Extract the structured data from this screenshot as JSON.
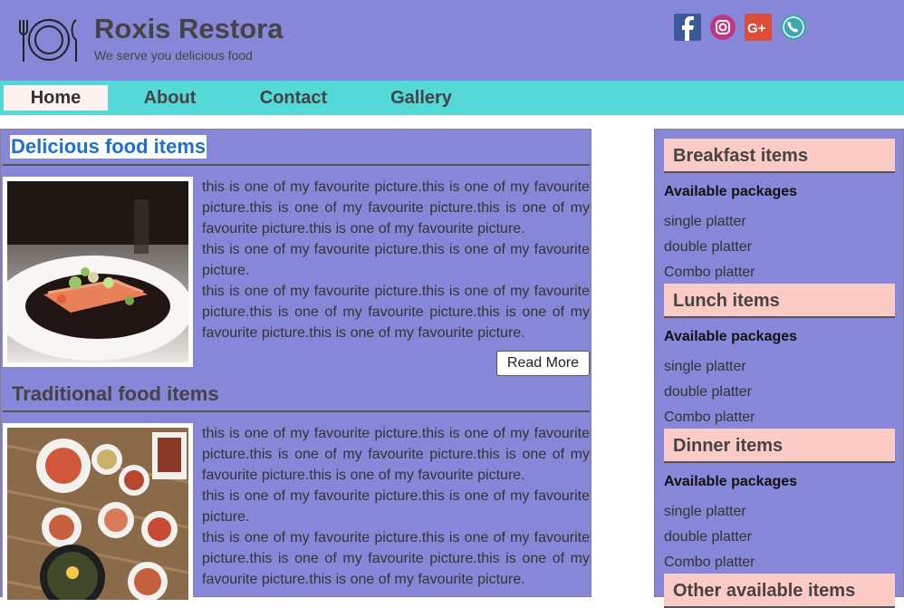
{
  "header": {
    "brand": "Roxis Restora",
    "tagline": "We serve you delicious food",
    "social": [
      "facebook-icon",
      "instagram-icon",
      "google-plus-icon",
      "phone-icon"
    ]
  },
  "nav": {
    "items": [
      "Home",
      "About",
      "Contact",
      "Gallery"
    ],
    "active": "Home"
  },
  "main": {
    "sections": [
      {
        "title": "Delicious food items",
        "paragraphs": [
          "this is one of my favourite picture.this is one of my favourite picture.this is one of my favourite picture.this is one of my favourite picture.this is one of my favourite picture.",
          "this is one of my favourite picture.this is one of my favourite picture.",
          "this is one of my favourite picture.this is one of my favourite picture.this is one of my favourite picture.this is one of my favourite picture.this is one of my favourite picture."
        ],
        "button": "Read More"
      },
      {
        "title": "Traditional food items",
        "paragraphs": [
          "this is one of my favourite picture.this is one of my favourite picture.this is one of my favourite picture.this is one of my favourite picture.this is one of my favourite picture.",
          "this is one of my favourite picture.this is one of my favourite picture.",
          "this is one of my favourite picture.this is one of my favourite picture.this is one of my favourite picture.this is one of my favourite picture.this is one of my favourite picture."
        ]
      }
    ]
  },
  "sidebar": {
    "categories": [
      {
        "title": "Breakfast items",
        "subtitle": "Available packages",
        "items": [
          "single platter",
          "double platter",
          "Combo platter"
        ]
      },
      {
        "title": "Lunch items",
        "subtitle": "Available packages",
        "items": [
          "single platter",
          "double platter",
          "Combo platter"
        ]
      },
      {
        "title": "Dinner items",
        "subtitle": "Available packages",
        "items": [
          "single platter",
          "double platter",
          "Combo platter"
        ]
      },
      {
        "title": "Other available items"
      }
    ]
  },
  "colors": {
    "header_bg": "#8787da",
    "nav_bg": "#54d8d8",
    "active_tab_bg": "#fdf2ef",
    "category_bg": "#fdcbc6",
    "title_blue": "#1e6fd0"
  }
}
